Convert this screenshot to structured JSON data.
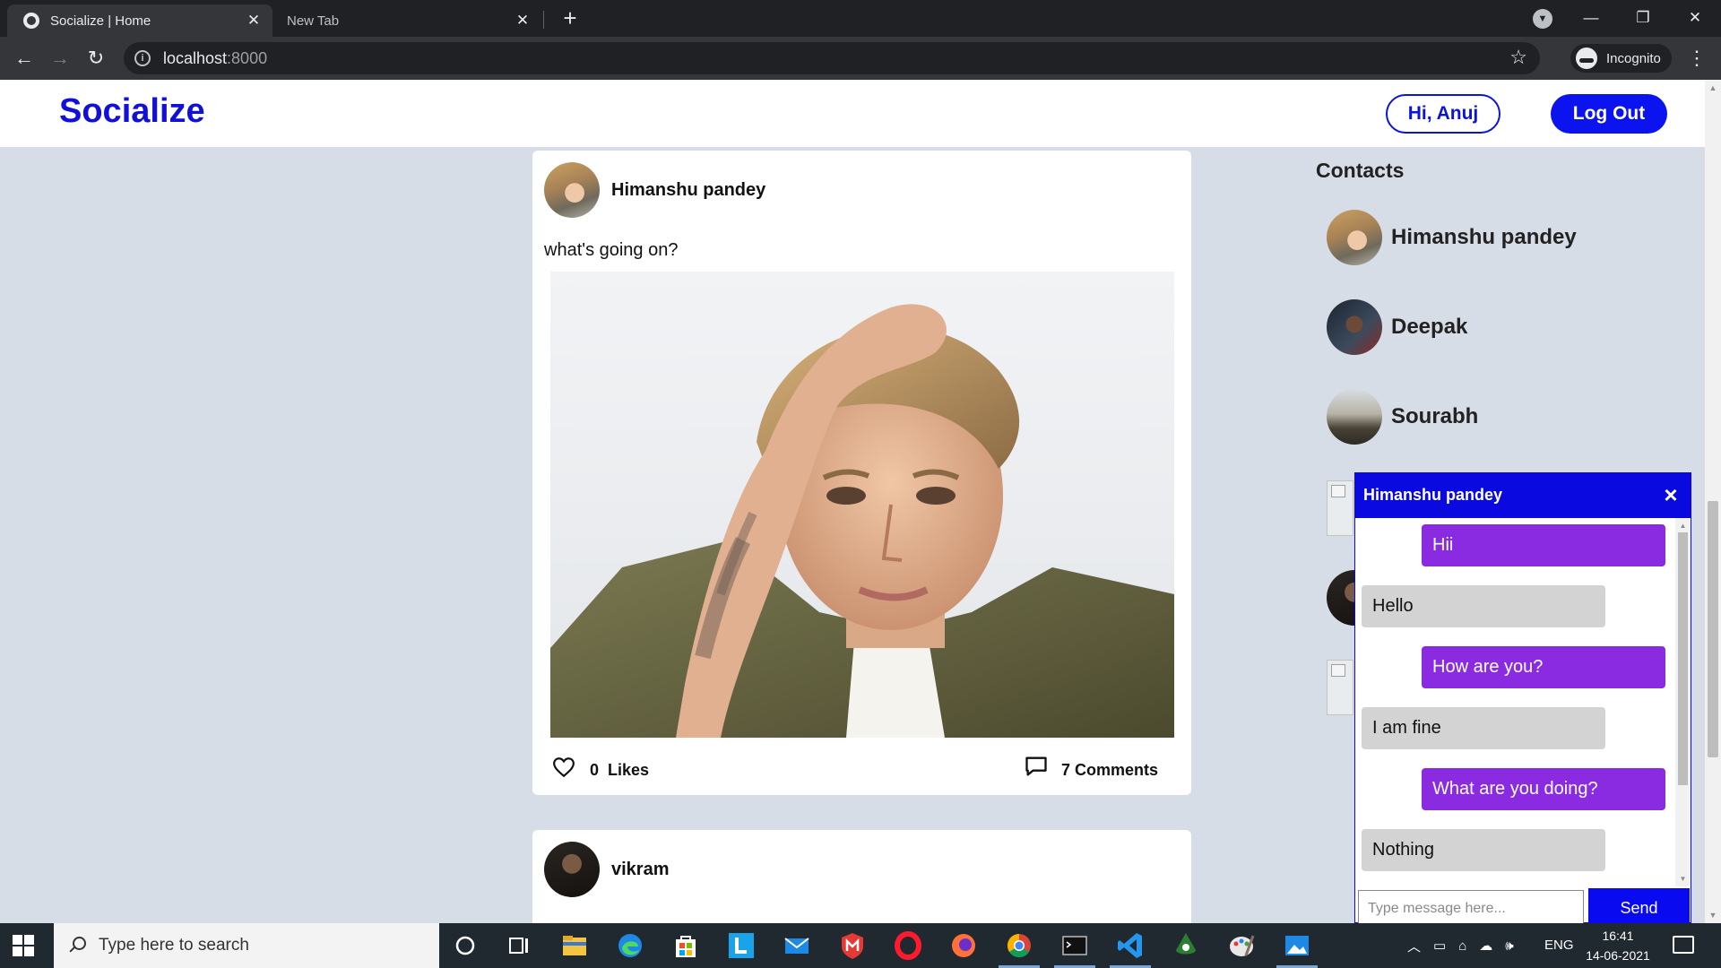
{
  "browser": {
    "tabs": [
      {
        "title": "Socialize | Home",
        "active": true
      },
      {
        "title": "New Tab",
        "active": false
      }
    ],
    "address": {
      "host": "localhost",
      "port": ":8000"
    },
    "profile_label": "Incognito"
  },
  "header": {
    "logo": "Socialize",
    "greeting": "Hi, Anuj",
    "logout": "Log Out",
    "accent": "#0b14ee"
  },
  "feed": {
    "posts": [
      {
        "author": "Himanshu pandey",
        "text": "what's going on?",
        "likes": "0",
        "likes_label": "Likes",
        "comments_label": "7 Comments"
      },
      {
        "author": "vikram"
      }
    ]
  },
  "contacts": {
    "title": "Contacts",
    "items": [
      {
        "name": "Himanshu pandey"
      },
      {
        "name": "Deepak"
      },
      {
        "name": "Sourabh"
      }
    ]
  },
  "chat": {
    "title": "Himanshu pandey",
    "messages": [
      {
        "text": "Hii",
        "direction": "sent"
      },
      {
        "text": "Hello",
        "direction": "received"
      },
      {
        "text": "How are you?",
        "direction": "sent"
      },
      {
        "text": "I am fine",
        "direction": "received"
      },
      {
        "text": "What are you doing?",
        "direction": "sent"
      },
      {
        "text": "Nothing",
        "direction": "received"
      }
    ],
    "input_placeholder": "Type message here...",
    "send_label": "Send",
    "sent_color": "#8a2be2",
    "received_color": "#d3d3d3"
  },
  "taskbar": {
    "search_placeholder": "Type here to search",
    "language": "ENG",
    "time": "16:41",
    "date": "14-06-2021"
  }
}
